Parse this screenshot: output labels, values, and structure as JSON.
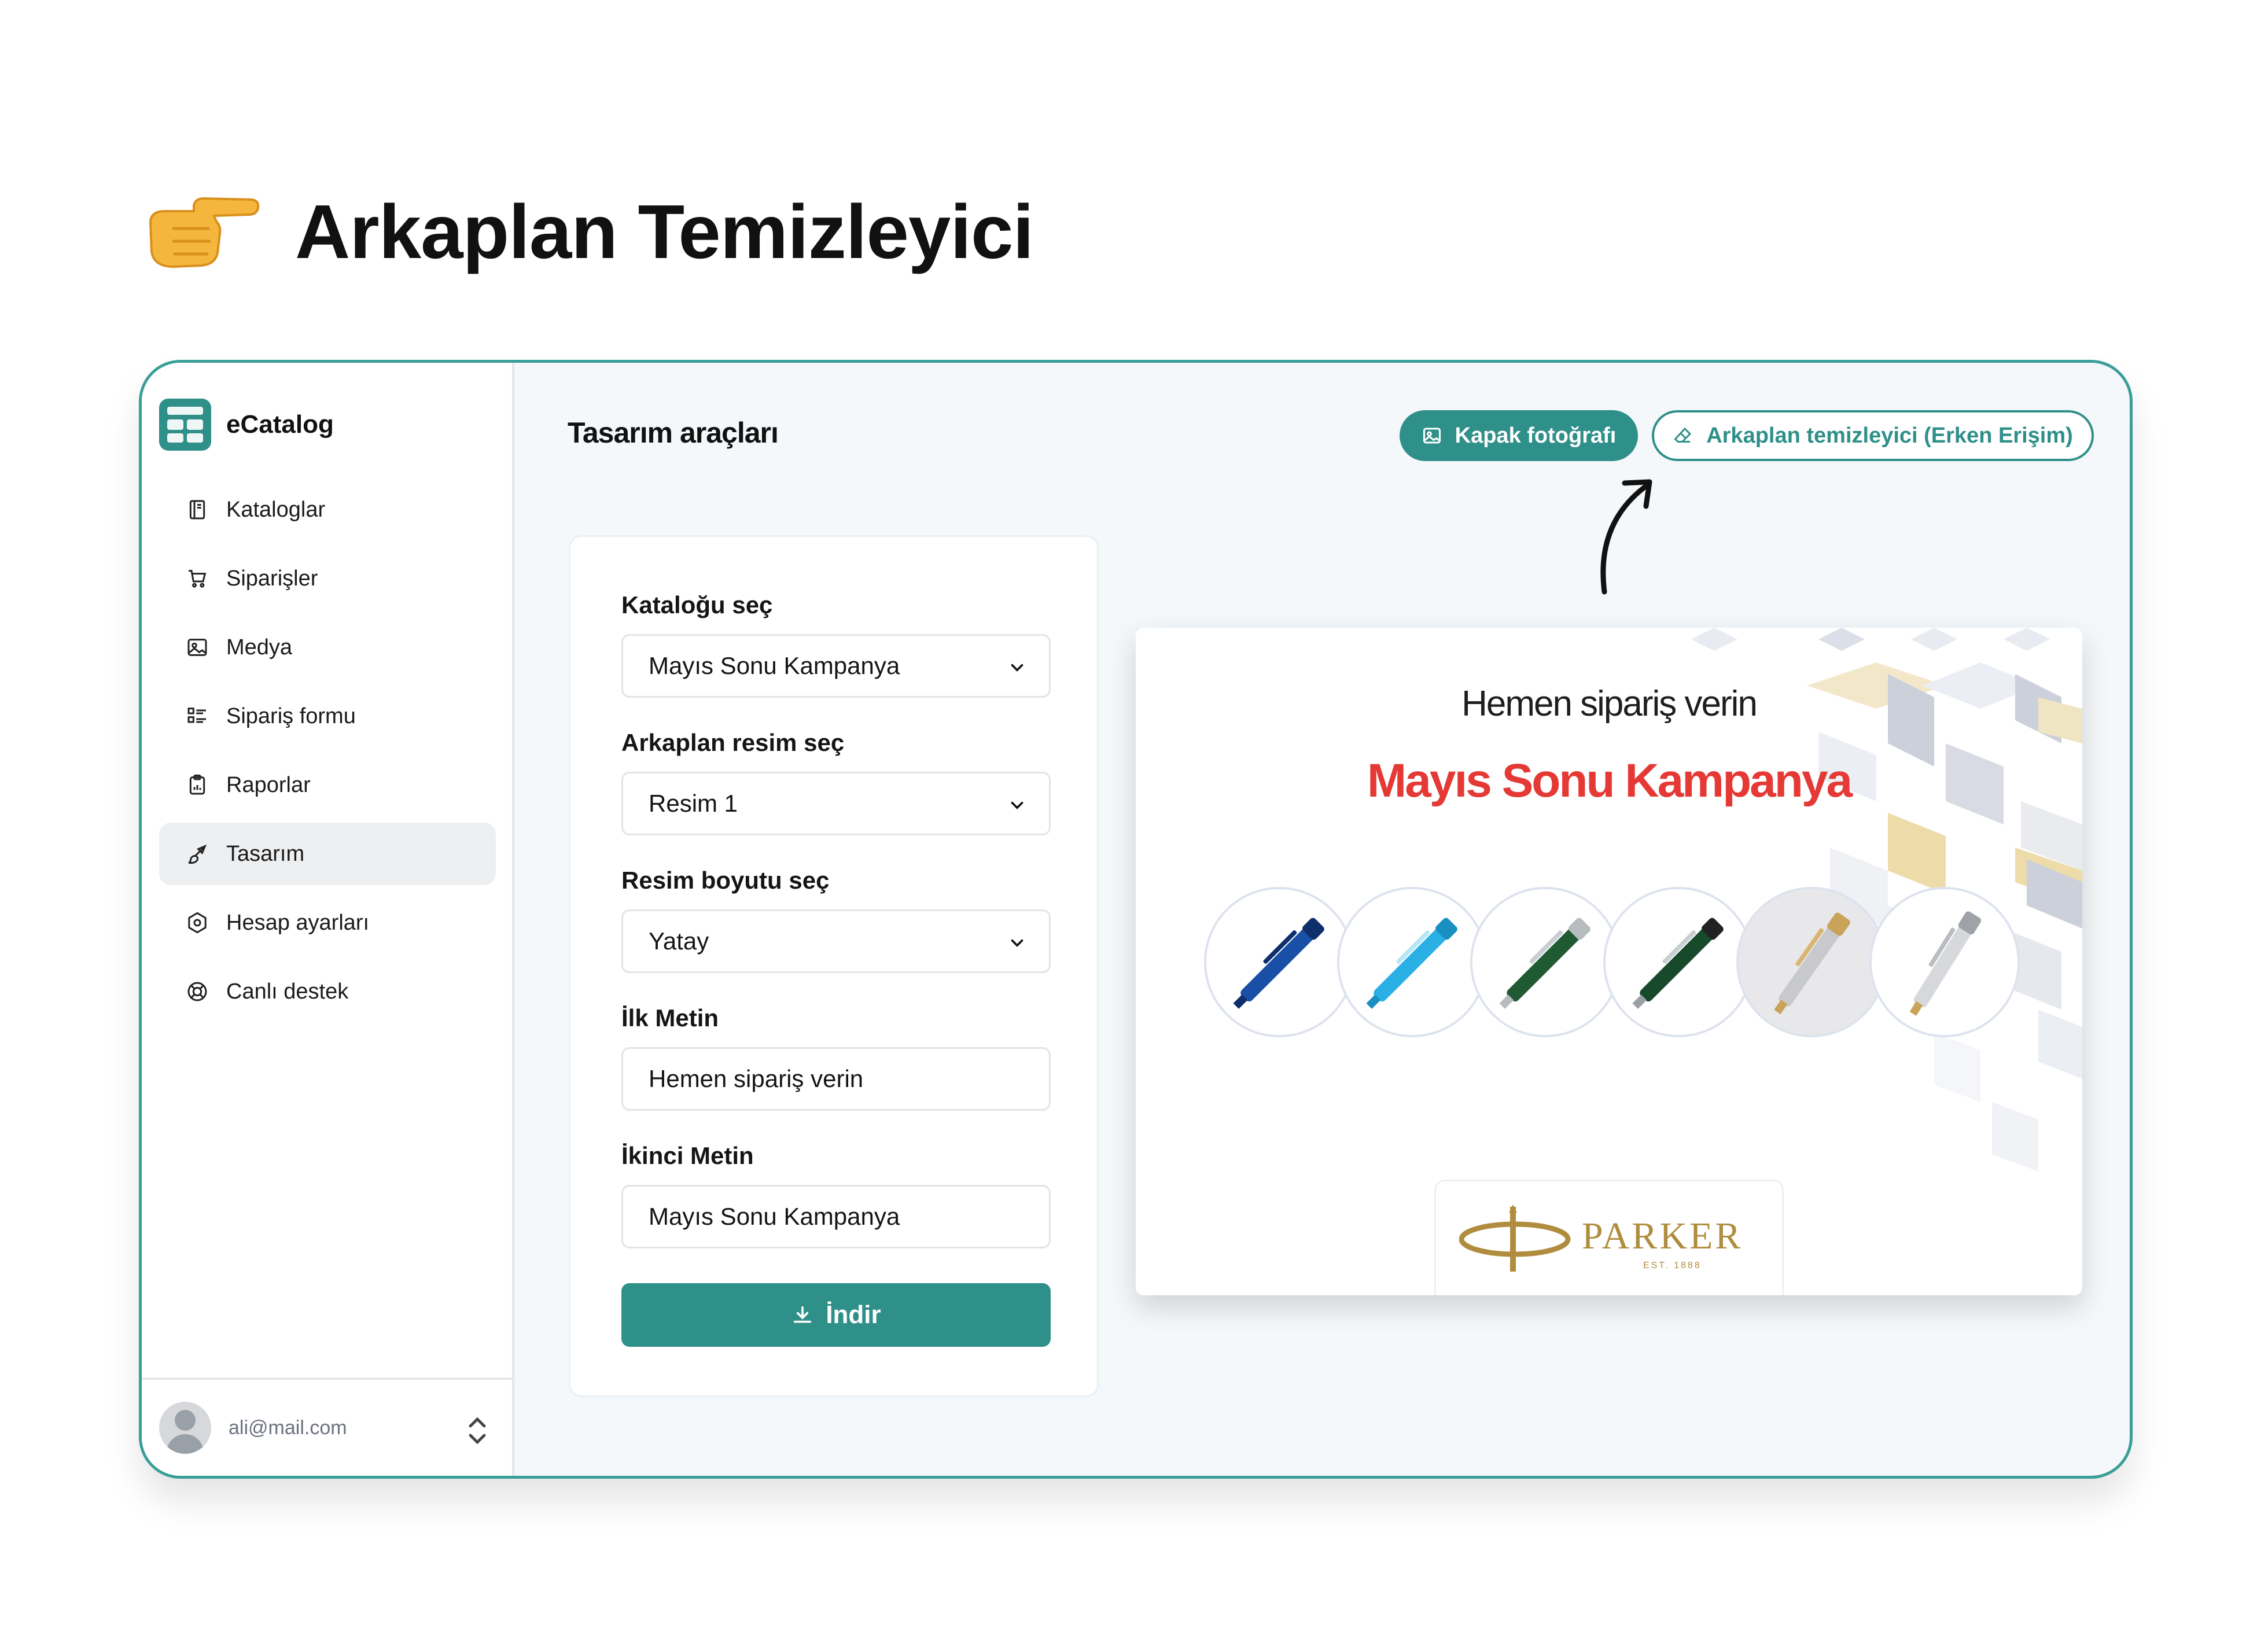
{
  "headline": {
    "title": "Arkaplan Temizleyici",
    "emoji_icon": "pointing-hand"
  },
  "app": {
    "brand": "eCatalog",
    "nav": [
      {
        "label": "Kataloglar",
        "icon": "book-icon"
      },
      {
        "label": "Siparişler",
        "icon": "cart-icon"
      },
      {
        "label": "Medya",
        "icon": "image-icon"
      },
      {
        "label": "Sipariş formu",
        "icon": "list-icon"
      },
      {
        "label": "Raporlar",
        "icon": "clipboard-icon"
      },
      {
        "label": "Tasarım",
        "icon": "brush-icon",
        "active": true
      },
      {
        "label": "Hesap ayarları",
        "icon": "settings-icon"
      },
      {
        "label": "Canlı destek",
        "icon": "lifebuoy-icon"
      }
    ],
    "user": {
      "email": "ali@mail.com"
    }
  },
  "main": {
    "title": "Tasarım araçları",
    "tabs": {
      "cover": "Kapak fotoğrafı",
      "bg_remover": "Arkaplan temizleyici (Erken Erişim)"
    },
    "form": {
      "catalog_label": "Kataloğu seç",
      "catalog_value": "Mayıs Sonu Kampanya",
      "bg_label": "Arkaplan resim seç",
      "bg_value": "Resim 1",
      "size_label": "Resim boyutu seç",
      "size_value": "Yatay",
      "first_text_label": "İlk Metin",
      "first_text_value": "Hemen sipariş verin",
      "second_text_label": "İkinci Metin",
      "second_text_value": "Mayıs Sonu Kampanya",
      "download": "İndir"
    },
    "preview": {
      "line1": "Hemen sipariş verin",
      "line2": "Mayıs Sonu Kampanya",
      "brand_logo": "PARKER",
      "brand_est": "EST. 1888"
    }
  },
  "colors": {
    "accent": "#2f8f89",
    "headline_red": "#e53935"
  }
}
